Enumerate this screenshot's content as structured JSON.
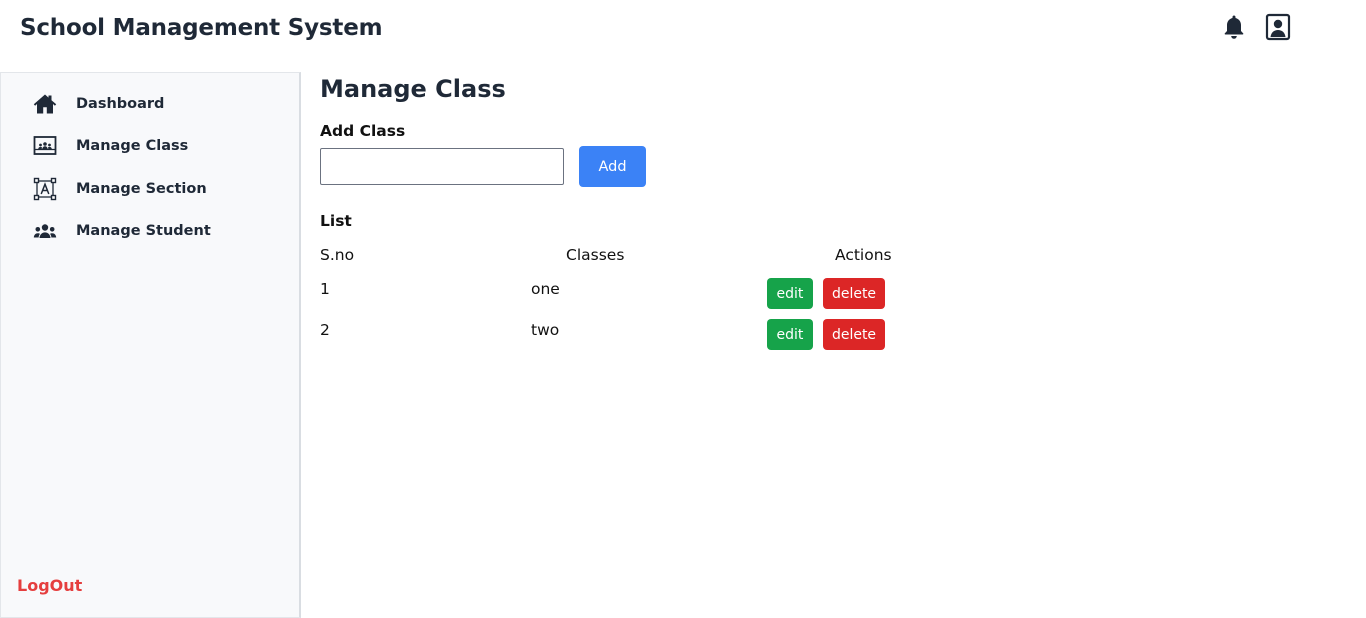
{
  "app": {
    "title": "School Management System",
    "icons": {
      "notifications": "bell-icon",
      "profile": "user-profile-icon"
    }
  },
  "sidebar": {
    "items": [
      {
        "label": "Dashboard",
        "icon": "home-icon"
      },
      {
        "label": "Manage Class",
        "icon": "classroom-icon"
      },
      {
        "label": "Manage Section",
        "icon": "section-icon"
      },
      {
        "label": "Manage Student",
        "icon": "students-icon"
      }
    ],
    "logout_label": "LogOut"
  },
  "main": {
    "page_title": "Manage Class",
    "add_section_label": "Add Class",
    "class_input": {
      "value": "",
      "placeholder": ""
    },
    "add_button_label": "Add",
    "list_label": "List",
    "table": {
      "headers": [
        "S.no",
        "Classes",
        "Actions"
      ],
      "rows": [
        {
          "sno": "1",
          "class": "one",
          "edit_label": "edit",
          "delete_label": "delete"
        },
        {
          "sno": "2",
          "class": "two",
          "edit_label": "edit",
          "delete_label": "delete"
        }
      ]
    }
  },
  "colors": {
    "primary": "#3b82f6",
    "success": "#16a34a",
    "danger": "#dc2626",
    "logout": "#e53e3e",
    "heading": "#1f2937"
  }
}
